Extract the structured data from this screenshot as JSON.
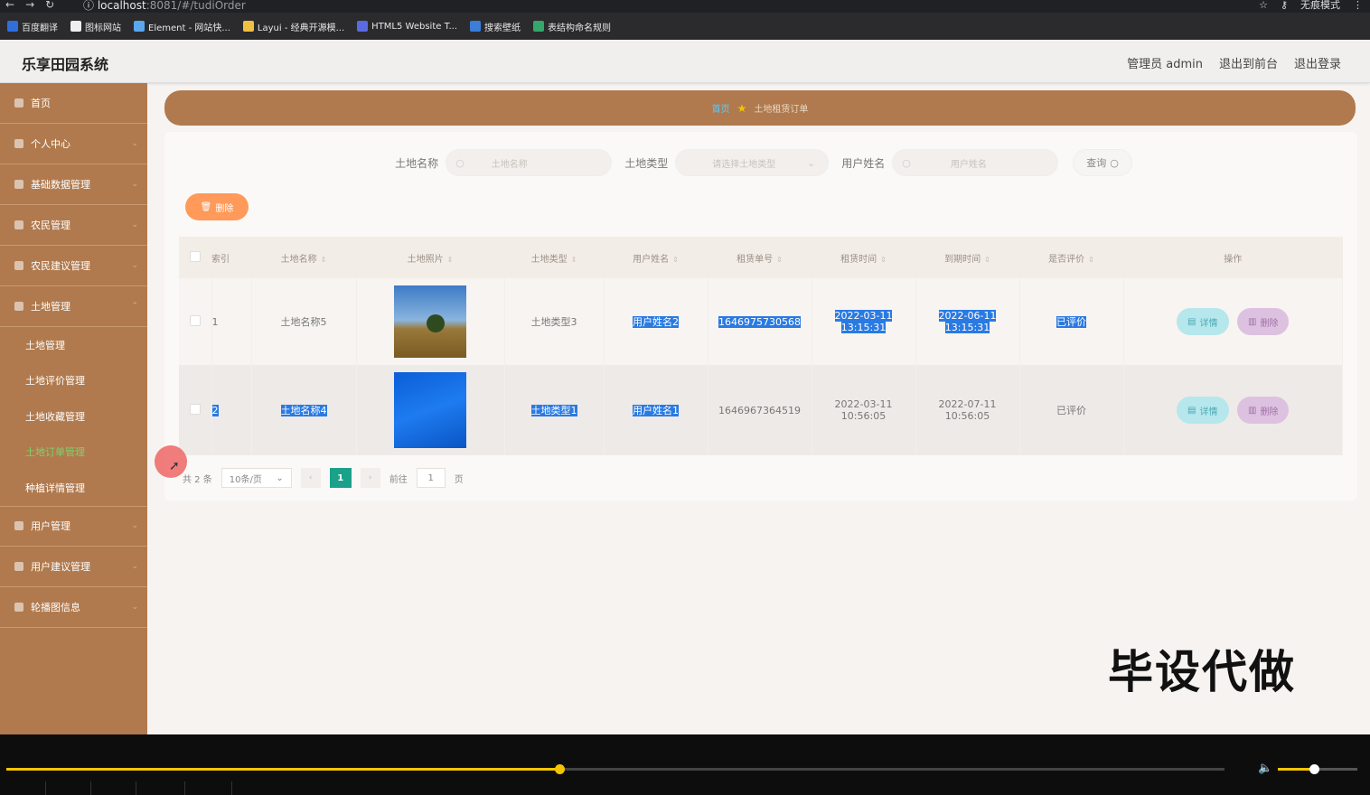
{
  "browser": {
    "url_host": "localhost",
    "url_rest": ":8081/#/tudiOrder",
    "mode_label": "无痕模式",
    "bookmarks": [
      "百度翻译",
      "图标网站",
      "Element - 网站快...",
      "Layui - 经典开源模...",
      "HTML5 Website T...",
      "搜索壁纸",
      "表结构命名规则"
    ],
    "bookmark_colors": [
      "#2f6fdc",
      "#eeeeee",
      "#5aa7f0",
      "#f0c040",
      "#5a6ae0",
      "#3b7dd8",
      "#34a86a"
    ]
  },
  "header": {
    "title": "乐享田园系统",
    "admin": "管理员 admin",
    "back_front": "退出到前台",
    "logout": "退出登录"
  },
  "sidebar": {
    "items": [
      {
        "label": "首页"
      },
      {
        "label": "个人中心"
      },
      {
        "label": "基础数据管理"
      },
      {
        "label": "农民管理"
      },
      {
        "label": "农民建议管理"
      },
      {
        "label": "土地管理"
      }
    ],
    "sub_items": [
      "土地管理",
      "土地评价管理",
      "土地收藏管理",
      "土地订单管理",
      "种植详情管理"
    ],
    "items_after": [
      {
        "label": "用户管理"
      },
      {
        "label": "用户建议管理"
      },
      {
        "label": "轮播图信息"
      }
    ]
  },
  "breadcrumb": {
    "home": "首页",
    "current": "土地租赁订单"
  },
  "search": {
    "land_name_label": "土地名称",
    "land_name_placeholder": "土地名称",
    "land_type_label": "土地类型",
    "land_type_placeholder": "请选择土地类型",
    "user_name_label": "用户姓名",
    "user_name_placeholder": "用户姓名",
    "query_label": "查询"
  },
  "bulk_delete_label": "删除",
  "table": {
    "headers": [
      "索引",
      "土地名称",
      "土地照片",
      "土地类型",
      "用户姓名",
      "租赁单号",
      "租赁时间",
      "到期时间",
      "是否评价",
      "操作"
    ],
    "rows": [
      {
        "index": "1",
        "land_name": "土地名称5",
        "land_type": "土地类型3",
        "user_name": "用户姓名2",
        "order_no": "1646975730568",
        "rent_time": "2022-03-11 13:15:31",
        "expire_time": "2022-06-11 13:15:31",
        "rated": "已评价"
      },
      {
        "index": "2",
        "land_name": "土地名称4",
        "land_type": "土地类型1",
        "user_name": "用户姓名1",
        "order_no": "1646967364519",
        "rent_time": "2022-03-11 10:56:05",
        "expire_time": "2022-07-11 10:56:05",
        "rated": "已评价"
      }
    ],
    "detail_label": "详情",
    "delete_label": "删除"
  },
  "pager": {
    "total": "共 2 条",
    "page_size": "10条/页",
    "current_page": "1",
    "goto_label": "前往",
    "goto_value": "1",
    "page_suffix": "页"
  },
  "watermark": "毕设代做",
  "player": {
    "progress": 0.454,
    "volume": 0.45
  }
}
